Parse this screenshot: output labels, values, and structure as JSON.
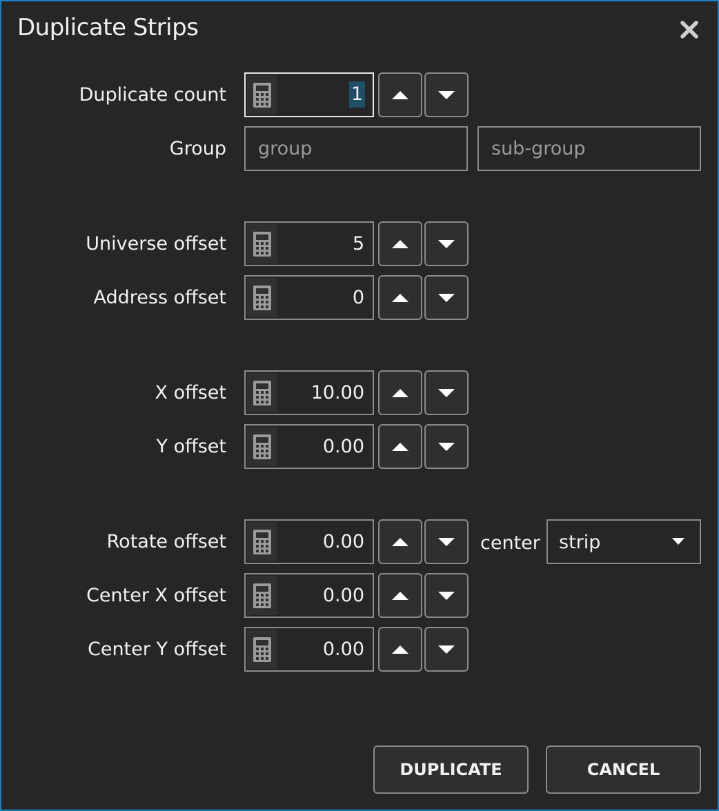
{
  "dialog": {
    "title": "Duplicate Strips",
    "accent": "#1b7fc7"
  },
  "fields": {
    "duplicate_count": {
      "label": "Duplicate count",
      "value": "1"
    },
    "group": {
      "label": "Group",
      "group_placeholder": "group",
      "subgroup_placeholder": "sub-group"
    },
    "universe_offset": {
      "label": "Universe offset",
      "value": "5"
    },
    "address_offset": {
      "label": "Address offset",
      "value": "0"
    },
    "x_offset": {
      "label": "X offset",
      "value": "10.00"
    },
    "y_offset": {
      "label": "Y offset",
      "value": "0.00"
    },
    "rotate_offset": {
      "label": "Rotate offset",
      "value": "0.00"
    },
    "center": {
      "label": "center",
      "selected": "strip"
    },
    "center_x_offset": {
      "label": "Center X offset",
      "value": "0.00"
    },
    "center_y_offset": {
      "label": "Center Y offset",
      "value": "0.00"
    }
  },
  "buttons": {
    "duplicate": "DUPLICATE",
    "cancel": "CANCEL"
  }
}
